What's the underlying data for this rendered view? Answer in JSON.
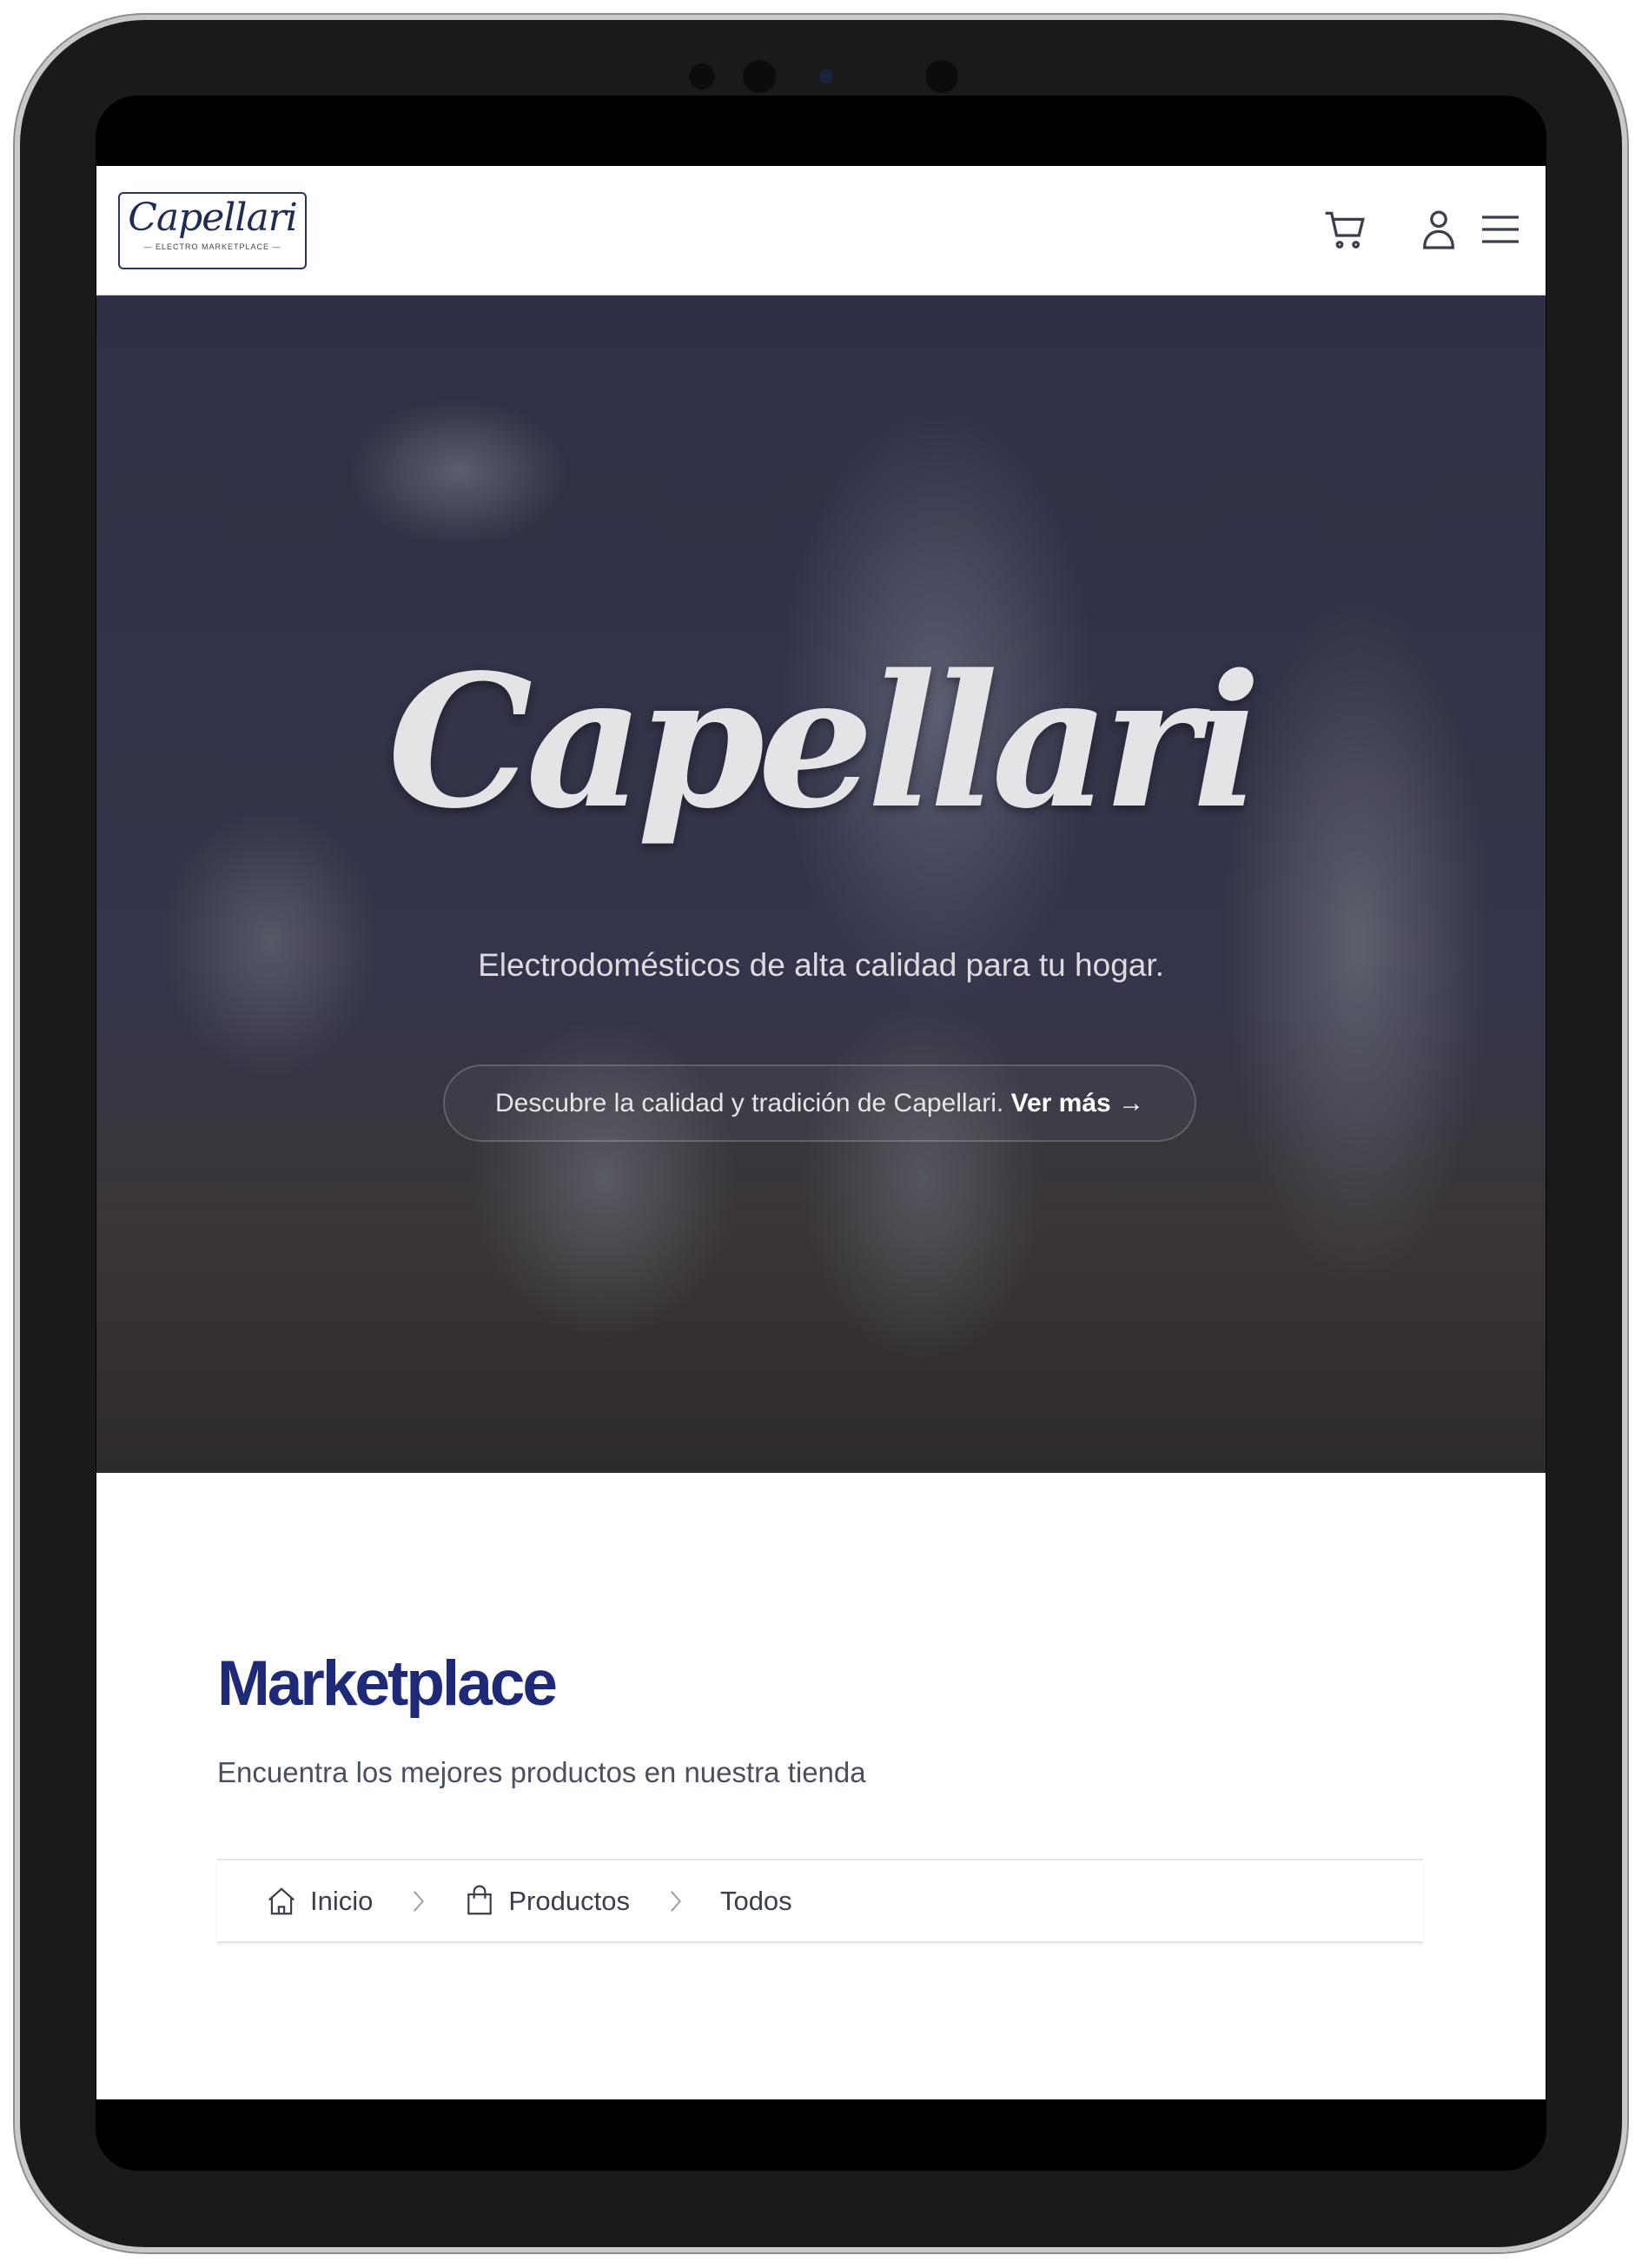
{
  "header": {
    "logo_script": "Capellari",
    "logo_tagline": "— ELECTRO MARKETPLACE —",
    "icons": [
      "cart-icon",
      "user-icon",
      "menu-icon"
    ]
  },
  "hero": {
    "title": "Capellari",
    "subtitle": "Electrodomésticos de alta calidad para tu hogar.",
    "cta_text": "Descubre la calidad y tradición de Capellari.",
    "cta_link": "Ver más →"
  },
  "main": {
    "title": "Marketplace",
    "subtitle": "Encuentra los mejores productos en nuestra tienda",
    "breadcrumb": [
      {
        "label": "Inicio",
        "icon": "home-icon"
      },
      {
        "label": "Productos",
        "icon": "shopping-bag-icon"
      },
      {
        "label": "Todos"
      }
    ]
  },
  "colors": {
    "title": "#1e2a78",
    "text": "#3b3f4c"
  }
}
